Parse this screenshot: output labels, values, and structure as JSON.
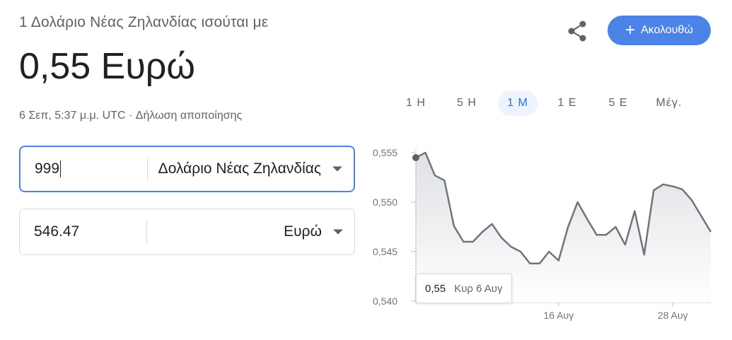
{
  "header": {
    "subtitle": "1 Δολάριο Νέας Ζηλανδίας ισούται με",
    "value": "0,55 Ευρώ",
    "timestamp": "6 Σεπ, 5:37 μ.μ. UTC · ",
    "disclaimer": "Δήλωση αποποίησης",
    "follow_label": "Ακολουθώ",
    "share_icon": "share-icon",
    "accent_color": "#4b83e6"
  },
  "converter": {
    "from": {
      "amount": "999",
      "currency": "Δολάριο Νέας Ζηλανδίας"
    },
    "to": {
      "amount": "546.47",
      "currency": "Ευρώ"
    }
  },
  "range_tabs": [
    {
      "label": "1 Η",
      "active": false
    },
    {
      "label": "5 Η",
      "active": false
    },
    {
      "label": "1 Μ",
      "active": true
    },
    {
      "label": "1 Ε",
      "active": false
    },
    {
      "label": "5 Ε",
      "active": false
    },
    {
      "label": "Μέγ.",
      "active": false
    }
  ],
  "tooltip": {
    "value": "0,55",
    "date": "Κυρ 6 Αυγ"
  },
  "chart_data": {
    "type": "area",
    "y_ticks": [
      "0,555",
      "0,550",
      "0,545",
      "0,540"
    ],
    "ylim": [
      0.54,
      0.555
    ],
    "x_ticks": [
      {
        "label": "16 Αυγ",
        "index": 15
      },
      {
        "label": "28 Αυγ",
        "index": 27
      }
    ],
    "series": [
      {
        "values": [
          0.5545,
          0.555,
          0.5527,
          0.5522,
          0.5476,
          0.546,
          0.546,
          0.547,
          0.5478,
          0.5464,
          0.5455,
          0.545,
          0.5438,
          0.5438,
          0.545,
          0.5441,
          0.5475,
          0.55,
          0.5483,
          0.5467,
          0.5467,
          0.5475,
          0.5457,
          0.5491,
          0.5447,
          0.5512,
          0.5518,
          0.5516,
          0.5513,
          0.5502,
          0.5486,
          0.547
        ]
      }
    ],
    "line_color": "#70757a",
    "grid": false
  }
}
